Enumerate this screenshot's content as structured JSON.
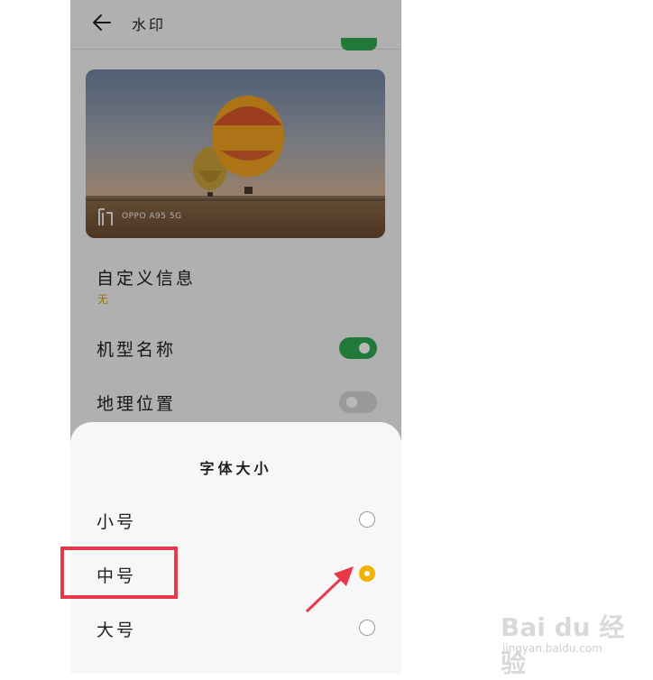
{
  "header": {
    "title": "水印"
  },
  "preview": {
    "watermark_text": "OPPO A95 5G"
  },
  "settings": {
    "custom_info": {
      "label": "自定义信息",
      "value": "无"
    },
    "model_name": {
      "label": "机型名称",
      "enabled": true
    },
    "location": {
      "label": "地理位置",
      "enabled": false
    }
  },
  "sheet": {
    "title": "字体大小",
    "options": [
      {
        "label": "小号",
        "selected": false
      },
      {
        "label": "中号",
        "selected": true
      },
      {
        "label": "大号",
        "selected": false
      }
    ]
  },
  "brand": {
    "name": "Bai du 经验",
    "url": "jingyan.baidu.com"
  },
  "colors": {
    "accent_toggle": "#2ea84f",
    "radio_selected": "#f5b100",
    "annotation": "#e8394a",
    "custom_info_value": "#d4a017"
  }
}
